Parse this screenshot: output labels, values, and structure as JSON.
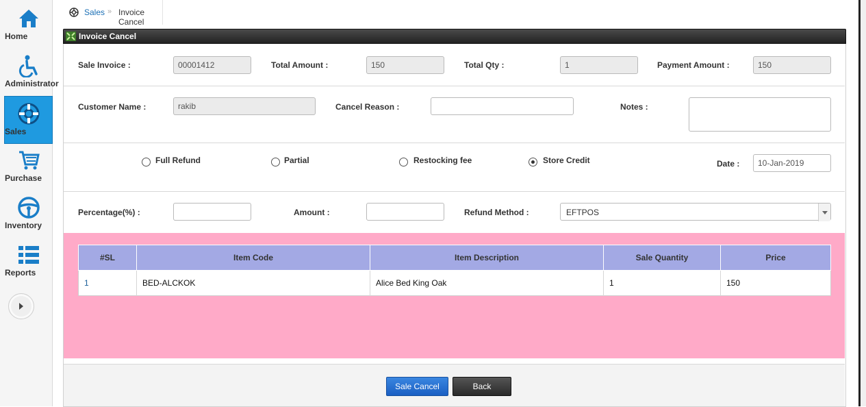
{
  "sidebar": {
    "items": [
      {
        "label": "Home",
        "icon": "home-icon"
      },
      {
        "label": "Administrator",
        "icon": "wheelchair-icon"
      },
      {
        "label": "Sales",
        "icon": "lifebuoy-icon",
        "active": true
      },
      {
        "label": "Purchase",
        "icon": "cart-icon"
      },
      {
        "label": "Inventory",
        "icon": "steering-wheel-icon"
      },
      {
        "label": "Reports",
        "icon": "list-icon"
      }
    ]
  },
  "breadcrumb": {
    "section": "Sales",
    "separator": "»",
    "current": "Invoice Cancel"
  },
  "panel": {
    "title": "Invoice Cancel"
  },
  "form": {
    "sale_invoice_label": "Sale Invoice :",
    "sale_invoice_value": "00001412",
    "total_amount_label": "Total Amount :",
    "total_amount_value": "150",
    "total_qty_label": "Total Qty :",
    "total_qty_value": "1",
    "payment_amount_label": "Payment Amount :",
    "payment_amount_value": "150",
    "customer_name_label": "Customer Name :",
    "customer_name_value": "rakib",
    "cancel_reason_label": "Cancel Reason :",
    "cancel_reason_value": "",
    "notes_label": "Notes :",
    "notes_value": "",
    "refund_options": [
      {
        "label": "Full Refund",
        "checked": false
      },
      {
        "label": "Partial",
        "checked": false
      },
      {
        "label": "Restocking fee",
        "checked": false
      },
      {
        "label": "Store Credit",
        "checked": true
      }
    ],
    "date_label": "Date :",
    "date_value": "10-Jan-2019",
    "percentage_label": "Percentage(%) :",
    "percentage_value": "",
    "amount_label": "Amount :",
    "amount_value": "",
    "refund_method_label": "Refund Method :",
    "refund_method_value": "EFTPOS"
  },
  "table": {
    "headers": [
      "#SL",
      "Item Code",
      "Item Description",
      "Sale Quantity",
      "Price"
    ],
    "rows": [
      [
        "1",
        "BED-ALCKOK",
        "Alice Bed King Oak",
        "1",
        "150"
      ]
    ]
  },
  "buttons": {
    "sale_cancel": "Sale Cancel",
    "back": "Back"
  },
  "colors": {
    "accent": "#1f9ae0",
    "table_header": "#a3a9e4",
    "pink_area": "#ffaac8",
    "primary_button": "#1a5fc3",
    "dark_button": "#2a2a2a"
  }
}
